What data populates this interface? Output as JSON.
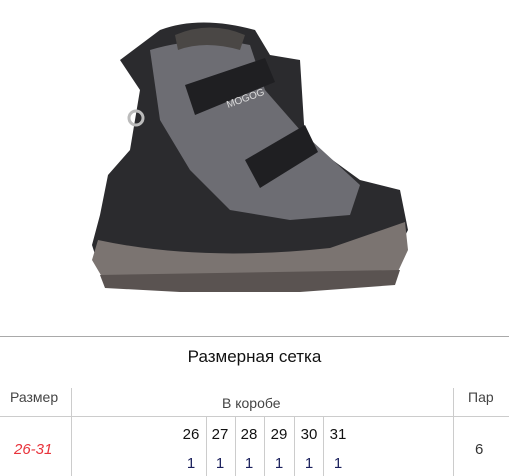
{
  "product_image": {
    "alt": "Детский зимний ботинок",
    "brand_logo": "MOGOG"
  },
  "size_chart": {
    "title": "Размерная сетка",
    "headers": {
      "size": "Размер",
      "in_box": "В коробе",
      "pairs": "Пар"
    },
    "row": {
      "size_range": "26-31",
      "sizes": [
        "26",
        "27",
        "28",
        "29",
        "30",
        "31"
      ],
      "quantities": [
        "1",
        "1",
        "1",
        "1",
        "1",
        "1"
      ],
      "pairs": "6"
    },
    "colors": {
      "size_range": "#e8333b"
    }
  }
}
